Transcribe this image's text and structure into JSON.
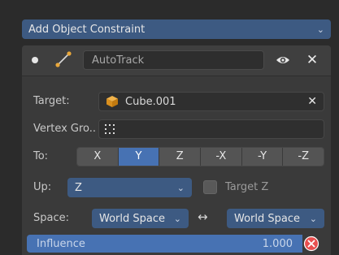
{
  "add_constraint": {
    "label": "Add Object Constraint"
  },
  "constraint": {
    "name": "AutoTrack",
    "target_label": "Target:",
    "target_value": "Cube.001",
    "vertex_group_label": "Vertex Gro..",
    "to_label": "To:",
    "to_options": [
      "X",
      "Y",
      "Z",
      "-X",
      "-Y",
      "-Z"
    ],
    "to_selected": "Y",
    "up_label": "Up:",
    "up_value": "Z",
    "target_z_label": "Target Z",
    "target_z_checked": false,
    "space_label": "Space:",
    "owner_space": "World Space",
    "arrow": "↔",
    "target_space": "World Space",
    "influence_label": "Influence",
    "influence_value": "1.000"
  },
  "icons": {
    "collapse": "collapse-dot-icon",
    "constraint_type": "track-constraint-icon",
    "visibility": "eye-icon",
    "delete": "close-icon",
    "object": "cube-object-icon",
    "vertex_group": "vertex-group-icon",
    "keyframe_clear": "clear-x-icon"
  },
  "colors": {
    "accent": "#4772b3",
    "dropdown": "#3d5a82",
    "danger": "#e84f4f"
  }
}
